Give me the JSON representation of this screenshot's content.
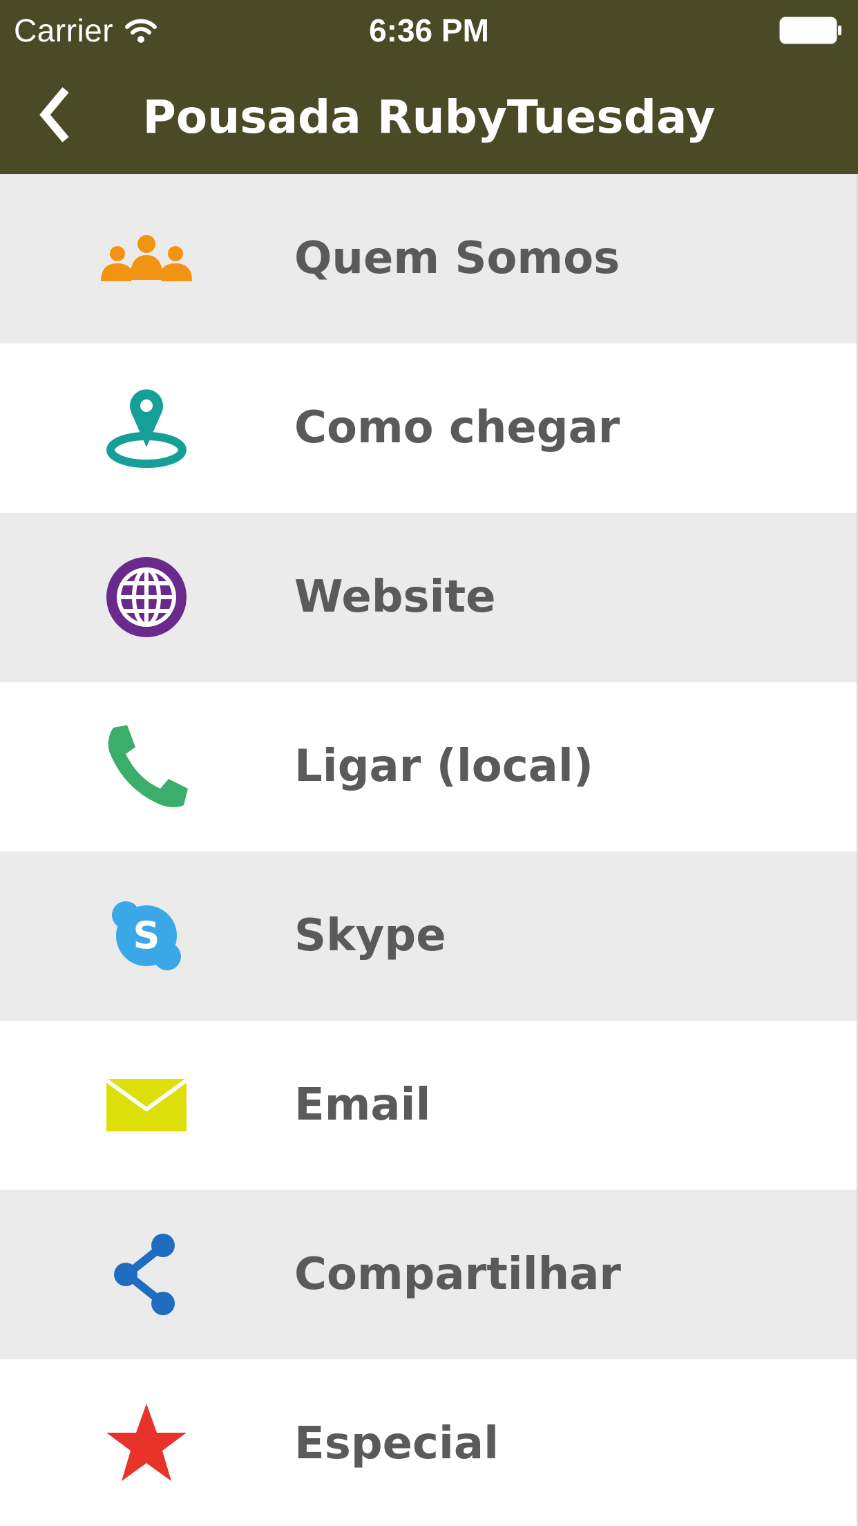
{
  "status_bar": {
    "carrier": "Carrier",
    "time": "6:36 PM"
  },
  "nav": {
    "title": "Pousada RubyTuesday",
    "back_icon": "chevron-left-icon"
  },
  "colors": {
    "header_background": "#4a4a26",
    "row_alt_background": "#ebebeb",
    "row_background": "#ffffff",
    "label_text": "#5a5a5a"
  },
  "menu": {
    "items": [
      {
        "label": "Quem Somos",
        "icon": "group-icon",
        "icon_color": "#f39313"
      },
      {
        "label": "Como chegar",
        "icon": "map-pin-icon",
        "icon_color": "#169f98"
      },
      {
        "label": "Website",
        "icon": "globe-icon",
        "icon_color": "#6a2a8c"
      },
      {
        "label": "Ligar (local)",
        "icon": "phone-icon",
        "icon_color": "#3aae6a"
      },
      {
        "label": "Skype",
        "icon": "skype-icon",
        "icon_color": "#3aa8e6"
      },
      {
        "label": "Email",
        "icon": "envelope-icon",
        "icon_color": "#dede0b"
      },
      {
        "label": "Compartilhar",
        "icon": "share-icon",
        "icon_color": "#1f6cc0"
      },
      {
        "label": "Especial",
        "icon": "star-icon",
        "icon_color": "#e8332a"
      }
    ]
  }
}
